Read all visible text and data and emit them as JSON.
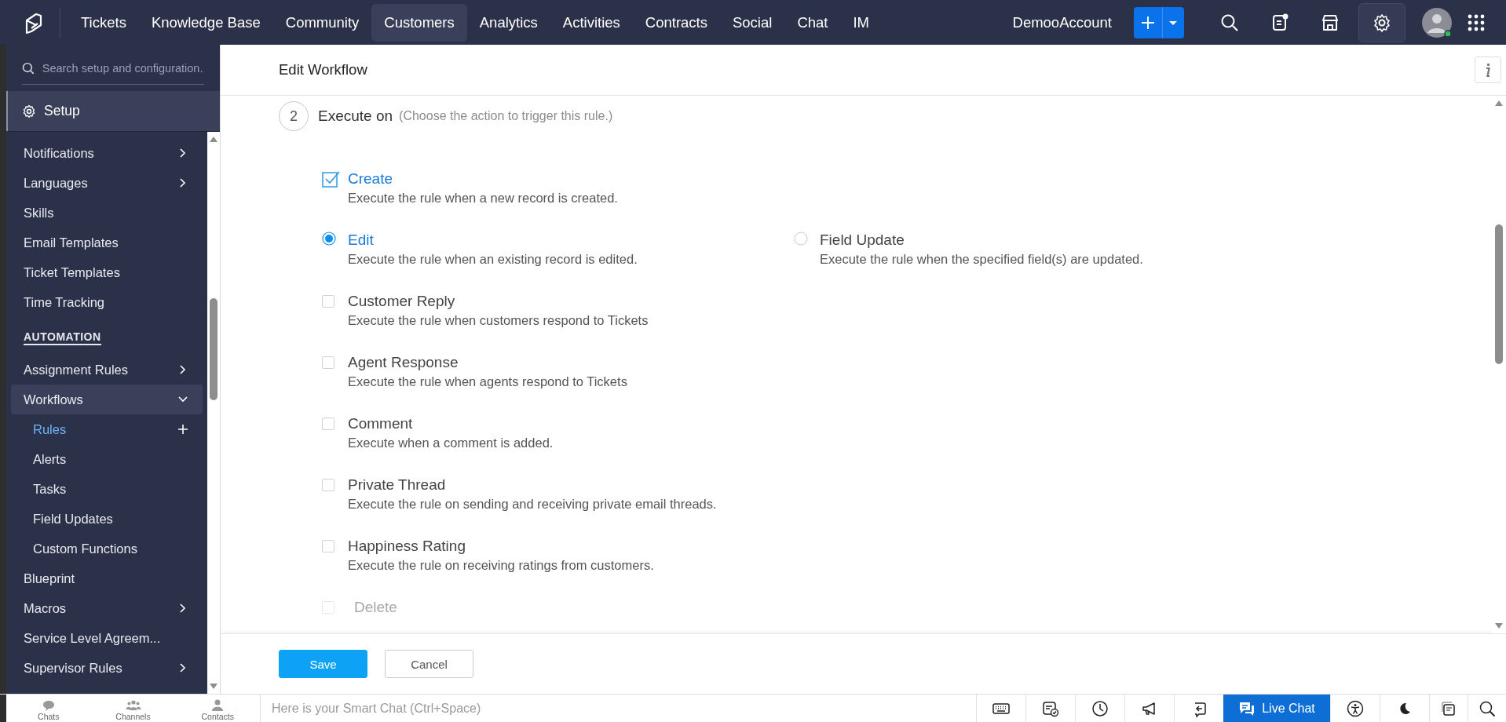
{
  "topbar": {
    "tabs": [
      {
        "label": "Tickets",
        "selected": false
      },
      {
        "label": "Knowledge Base",
        "selected": false
      },
      {
        "label": "Community",
        "selected": false
      },
      {
        "label": "Customers",
        "selected": true
      },
      {
        "label": "Analytics",
        "selected": false
      },
      {
        "label": "Activities",
        "selected": false
      },
      {
        "label": "Contracts",
        "selected": false
      },
      {
        "label": "Social",
        "selected": false
      },
      {
        "label": "Chat",
        "selected": false
      },
      {
        "label": "IM",
        "selected": false
      }
    ],
    "account": "DemooAccount"
  },
  "sidebar": {
    "search": {
      "placeholder": "Search setup and configuration.."
    },
    "header": "Setup",
    "sections": [
      {
        "items": [
          {
            "label": "Notifications",
            "expanded": false
          },
          {
            "label": "Languages",
            "expanded": false
          },
          {
            "label": "Skills"
          },
          {
            "label": "Email Templates"
          },
          {
            "label": "Ticket Templates"
          },
          {
            "label": "Time Tracking"
          }
        ]
      },
      {
        "title": "AUTOMATION",
        "items": [
          {
            "label": "Assignment Rules",
            "expanded": false
          },
          {
            "label": "Workflows",
            "expanded": true,
            "children": [
              {
                "label": "Rules",
                "selected": true,
                "addable": true
              },
              {
                "label": "Alerts",
                "selected": false,
                "addable": false
              },
              {
                "label": "Tasks",
                "selected": false,
                "addable": false
              },
              {
                "label": "Field Updates",
                "selected": false,
                "addable": false
              },
              {
                "label": "Custom Functions",
                "selected": false,
                "addable": false
              }
            ]
          },
          {
            "label": "Blueprint"
          },
          {
            "label": "Macros",
            "expanded": false
          },
          {
            "label": "Service Level Agreem..."
          },
          {
            "label": "Supervisor Rules",
            "expanded": false
          }
        ]
      }
    ]
  },
  "main": {
    "title": "Edit Workflow",
    "step": {
      "number": "2",
      "title": "Execute on",
      "hint": "(Choose the action to trigger this rule.)"
    },
    "rows": [
      {
        "options": [
          {
            "kind": "checkbox",
            "label": "Create",
            "description": "Execute the rule when a new record is created.",
            "checked": true,
            "disabled": false
          }
        ]
      },
      {
        "options": [
          {
            "kind": "radio",
            "label": "Edit",
            "description": "Execute the rule when an existing record is edited.",
            "selected": true,
            "disabled": false
          },
          {
            "kind": "radio",
            "label": "Field Update",
            "description": "Execute the rule when the specified field(s) are updated.",
            "selected": false,
            "disabled": false
          }
        ]
      },
      {
        "options": [
          {
            "kind": "checkbox",
            "label": "Customer Reply",
            "description": "Execute the rule when customers respond to Tickets",
            "checked": false,
            "disabled": false
          }
        ]
      },
      {
        "options": [
          {
            "kind": "checkbox",
            "label": "Agent Response",
            "description": "Execute the rule when agents respond to Tickets",
            "checked": false,
            "disabled": false
          }
        ]
      },
      {
        "options": [
          {
            "kind": "checkbox",
            "label": "Comment",
            "description": "Execute when a comment is added.",
            "checked": false,
            "disabled": false
          }
        ]
      },
      {
        "options": [
          {
            "kind": "checkbox",
            "label": "Private Thread",
            "description": "Execute the rule on sending and receiving private email threads.",
            "checked": false,
            "disabled": false
          }
        ]
      },
      {
        "options": [
          {
            "kind": "checkbox",
            "label": "Happiness Rating",
            "description": "Execute the rule on receiving ratings from customers.",
            "checked": false,
            "disabled": false
          }
        ]
      },
      {
        "options": [
          {
            "kind": "checkbox",
            "label": "Delete",
            "checked": false,
            "disabled": true
          }
        ]
      }
    ],
    "buttons": [
      {
        "label": "Save",
        "kind": "primary"
      },
      {
        "label": "Cancel",
        "kind": "secondary"
      }
    ]
  },
  "bottombar": {
    "apps": [
      {
        "label": "Chats"
      },
      {
        "label": "Channels"
      },
      {
        "label": "Contacts"
      }
    ],
    "smart_chat": {
      "placeholder": "Here is your Smart Chat (Ctrl+Space)"
    },
    "live_chat": "Live Chat"
  }
}
